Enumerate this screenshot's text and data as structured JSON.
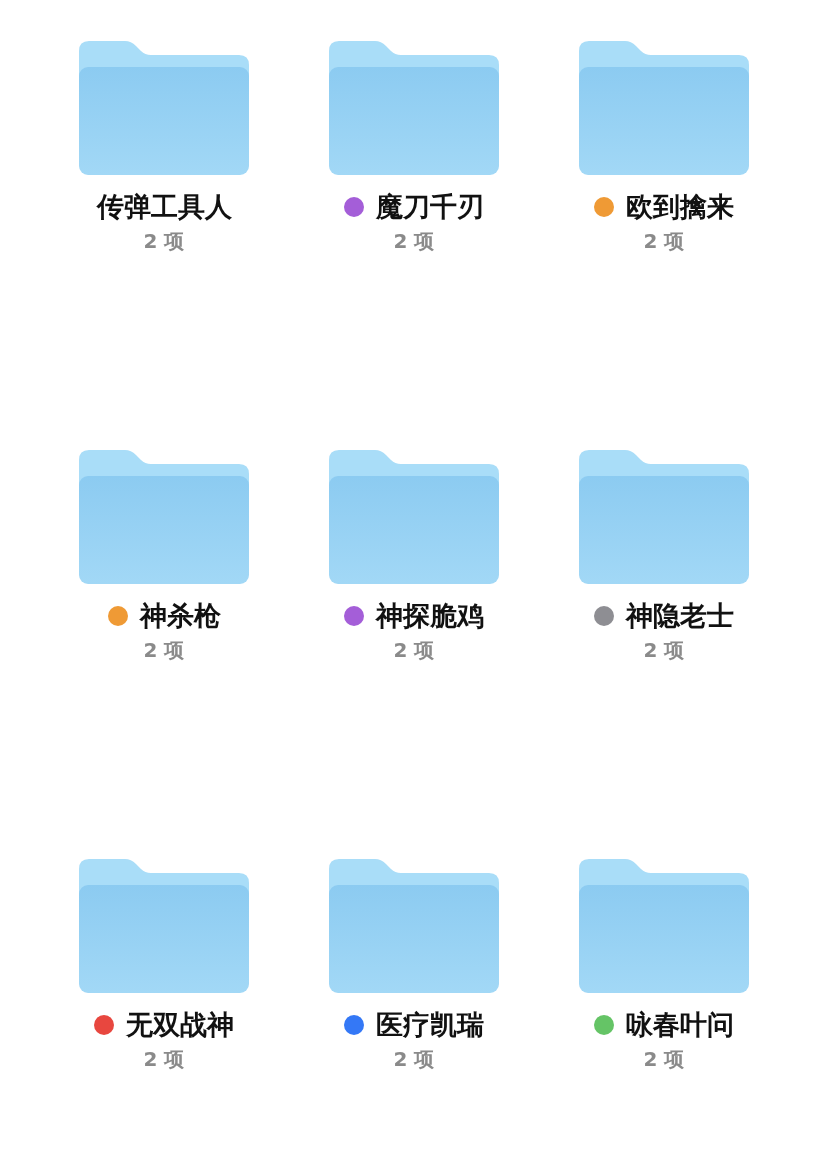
{
  "folders": [
    {
      "name": "传弹工具人",
      "count": "2 项"
    },
    {
      "name": "魔刀千刃",
      "count": "2 项",
      "color": "#a45ed8"
    },
    {
      "name": "欧到擒来",
      "count": "2 项",
      "color": "#ef9a35"
    },
    {
      "name": "神杀枪",
      "count": "2 项",
      "color": "#ef9a35"
    },
    {
      "name": "神探脆鸡",
      "count": "2 项",
      "color": "#a45ed8"
    },
    {
      "name": "神隐老士",
      "count": "2 项",
      "color": "#8e8e93"
    },
    {
      "name": "无双战神",
      "count": "2 项",
      "color": "#e8473f"
    },
    {
      "name": "医疗凯瑞",
      "count": "2 项",
      "color": "#3478f6"
    },
    {
      "name": "咏春叶问",
      "count": "2 项",
      "color": "#65c466"
    }
  ]
}
